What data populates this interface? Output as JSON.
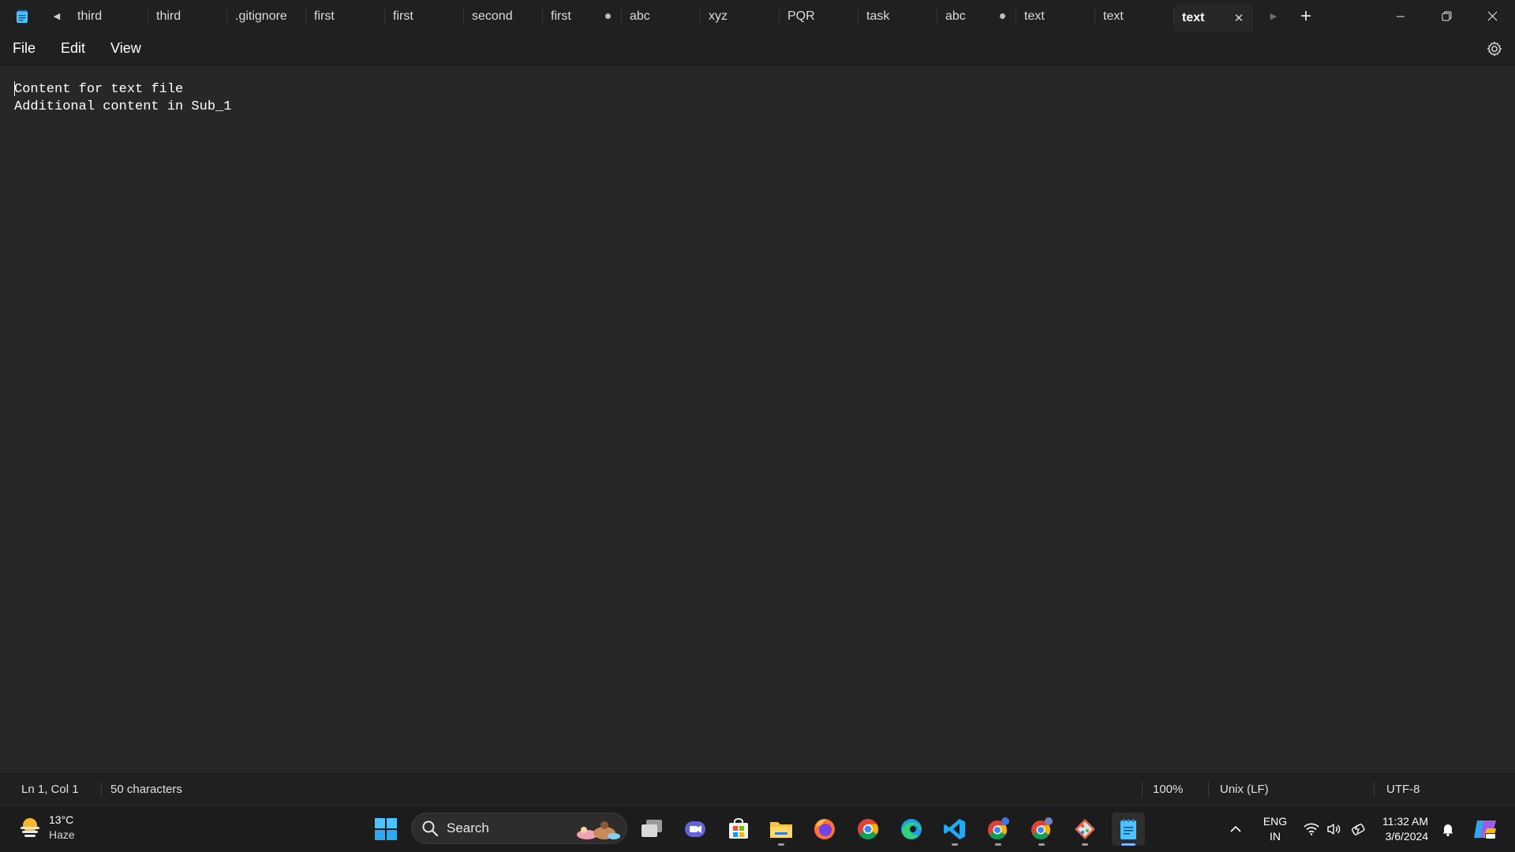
{
  "tabs": [
    {
      "label": "third",
      "modified": false
    },
    {
      "label": "third",
      "modified": false
    },
    {
      "label": ".gitignore",
      "modified": false
    },
    {
      "label": "first",
      "modified": false
    },
    {
      "label": "first",
      "modified": false
    },
    {
      "label": "second",
      "modified": false
    },
    {
      "label": "first",
      "modified": true
    },
    {
      "label": "abc",
      "modified": false
    },
    {
      "label": "xyz",
      "modified": false
    },
    {
      "label": "PQR",
      "modified": false
    },
    {
      "label": "task",
      "modified": false
    },
    {
      "label": "abc",
      "modified": true
    },
    {
      "label": "text",
      "modified": false
    },
    {
      "label": "text",
      "modified": false
    },
    {
      "label": "text",
      "modified": false,
      "active": true
    }
  ],
  "menu": {
    "file": "File",
    "edit": "Edit",
    "view": "View"
  },
  "editor": {
    "lines": [
      "Content for text file",
      "Additional content in Sub_1"
    ]
  },
  "status": {
    "position": "Ln 1, Col 1",
    "characters": "50 characters",
    "zoom": "100%",
    "line_ending": "Unix (LF)",
    "encoding": "UTF-8"
  },
  "taskbar": {
    "weather": {
      "temp": "13°C",
      "condition": "Haze"
    },
    "search_label": "Search",
    "apps": [
      "start-icon",
      "task-view-icon",
      "teams-icon",
      "store-icon",
      "file-explorer-icon",
      "firefox-icon",
      "chrome-icon",
      "edge-icon",
      "vscode-icon",
      "chrome-profile-icon",
      "chrome-profile-icon",
      "git-icon",
      "notepad-icon"
    ],
    "language": {
      "line1": "ENG",
      "line2": "IN"
    },
    "time": "11:32 AM",
    "date": "3/6/2024"
  },
  "colors": {
    "background": "#272727",
    "chrome": "#202020",
    "taskbar": "#1c1c1c",
    "accent": "#4cc2ff"
  }
}
